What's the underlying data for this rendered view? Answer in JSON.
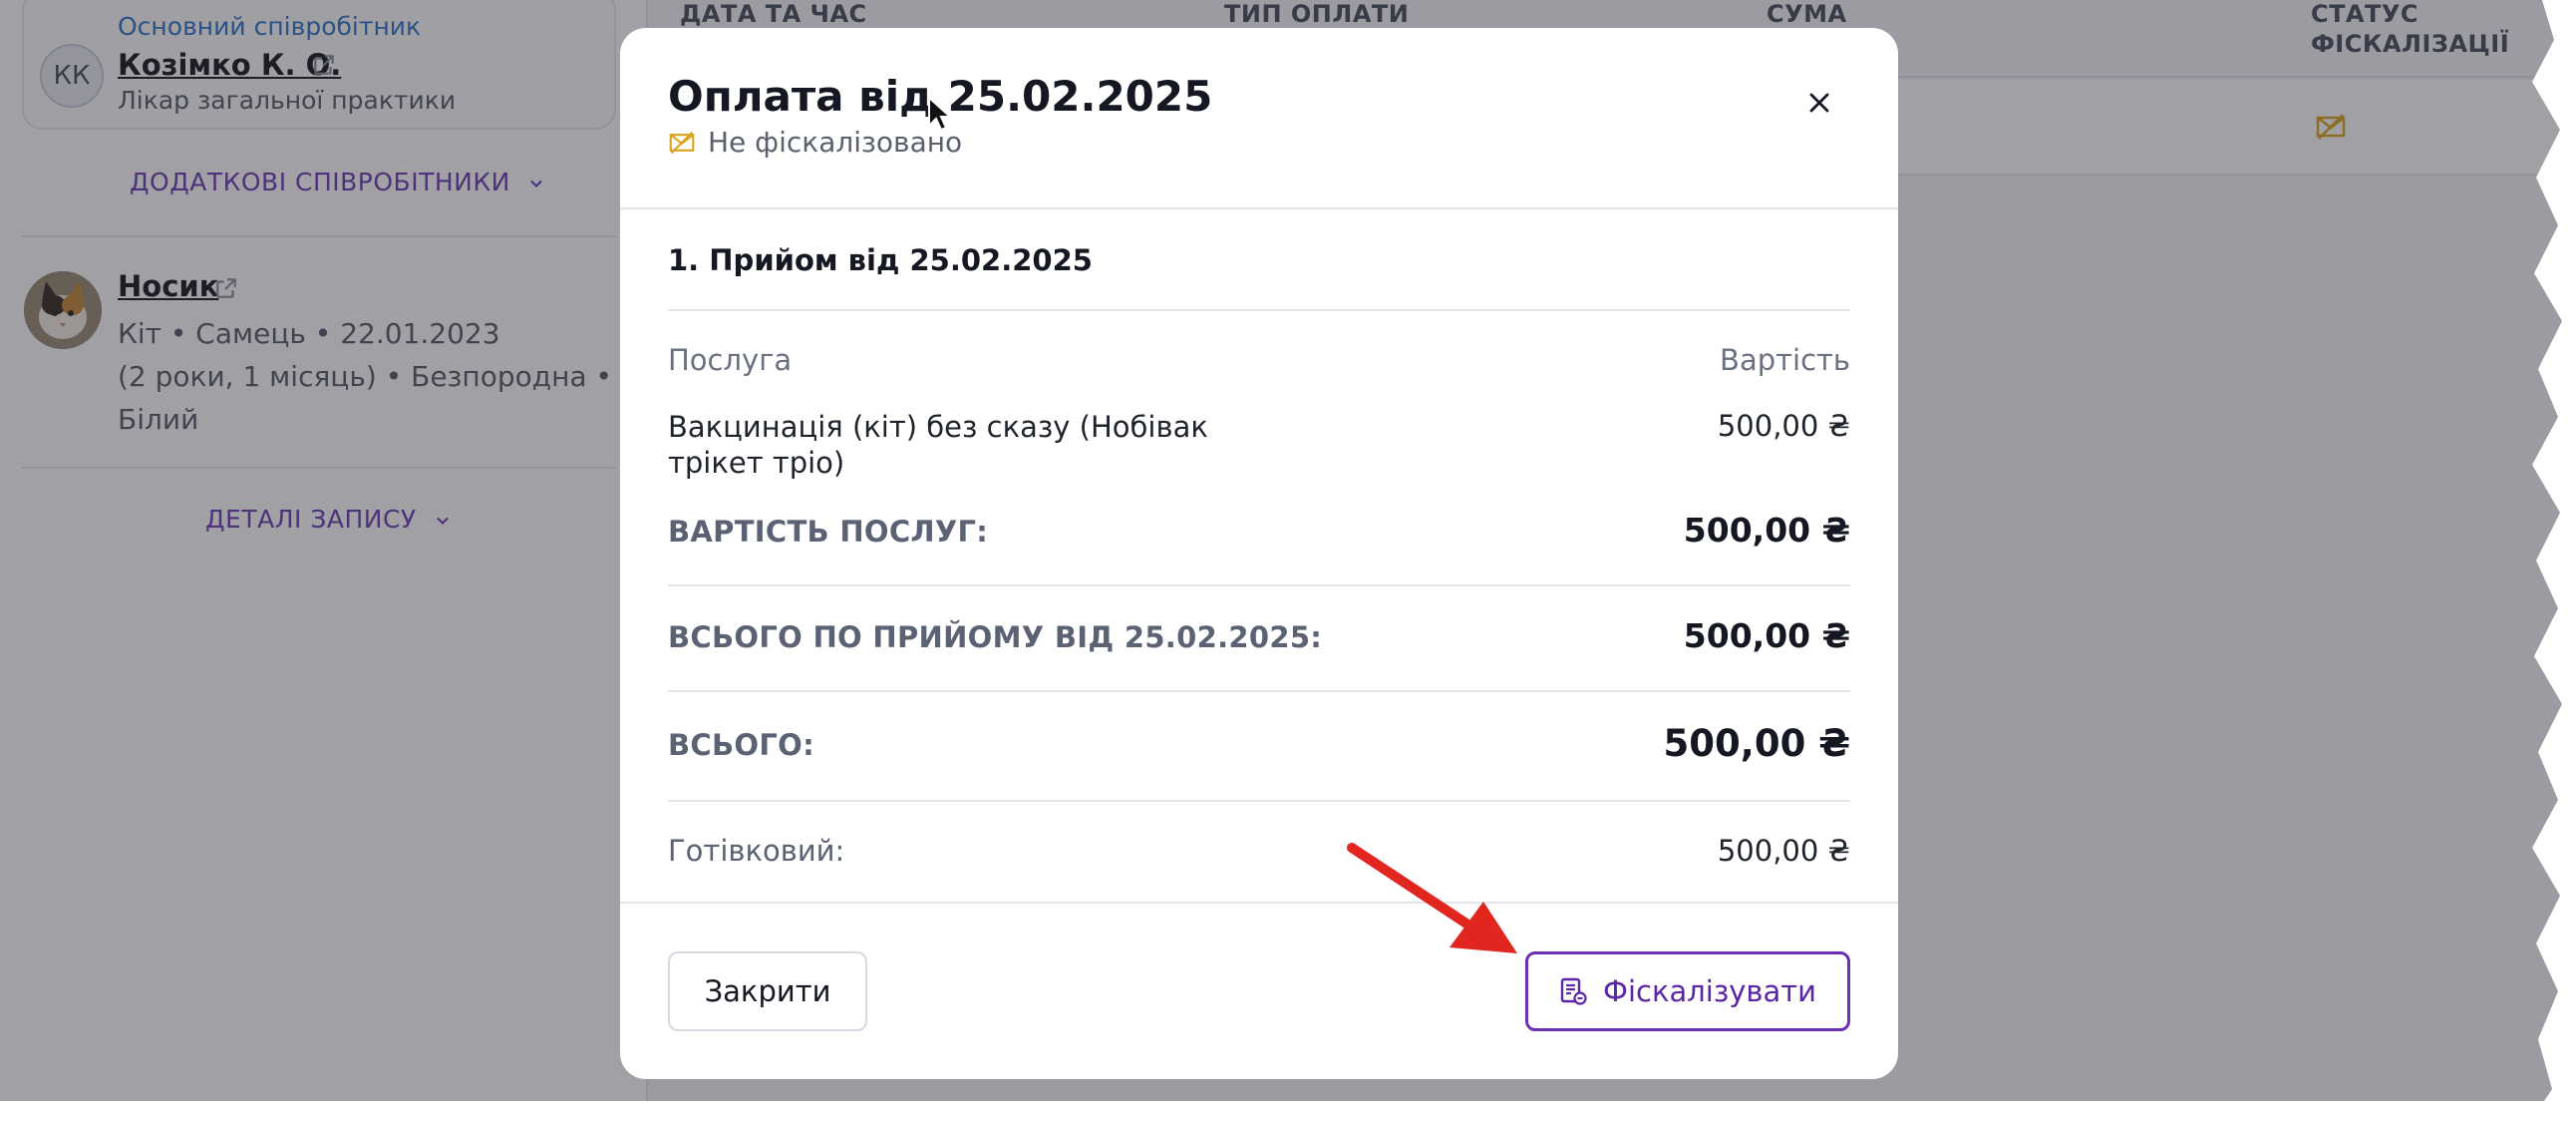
{
  "staff": {
    "role": "Основний співробітник",
    "initials": "КК",
    "name": "Козімко К. О.",
    "specialty": "Лікар загальної практики",
    "more_staff": "ДОДАТКОВІ СПІВРОБІТНИКИ"
  },
  "pet": {
    "name": "Носик",
    "line1": "Кіт • Самець • 22.01.2023",
    "line2": "(2 роки, 1 місяць) • Безпородна •",
    "line3": "Білий",
    "details": "ДЕТАЛІ ЗАПИСУ"
  },
  "table": {
    "headers": [
      "ДАТА ТА ЧАС",
      "ТИП ОПЛАТИ",
      "СУМА",
      "СТАТУС",
      "ФІСКАЛІЗАЦІЇ"
    ]
  },
  "modal": {
    "title": "Оплата від 25.02.2025",
    "status": "Не фіскалізовано",
    "visit_title": "1. Прийом від 25.02.2025",
    "col_service": "Послуга",
    "col_cost": "Вартість",
    "service_name": "Вакцинація (кіт) без сказу (Нобівак трікет тріо)",
    "service_price": "500,00 ₴",
    "services_total_label": "ВАРТІСТЬ ПОСЛУГ:",
    "services_total_value": "500,00 ₴",
    "visit_total_label": "ВСЬОГО ПО ПРИЙОМУ ВІД 25.02.2025:",
    "visit_total_value": "500,00 ₴",
    "grand_total_label": "ВСЬОГО:",
    "grand_total_value": "500,00 ₴",
    "payment_label": "Готівковий:",
    "payment_value": "500,00 ₴",
    "close_button": "Закрити",
    "fiscalize_button": "Фіскалізувати"
  },
  "colors": {
    "accent": "#6a2fb3",
    "link_blue": "#3576c8",
    "warning_icon": "#d9a521",
    "arrow_red": "#e0261e"
  }
}
